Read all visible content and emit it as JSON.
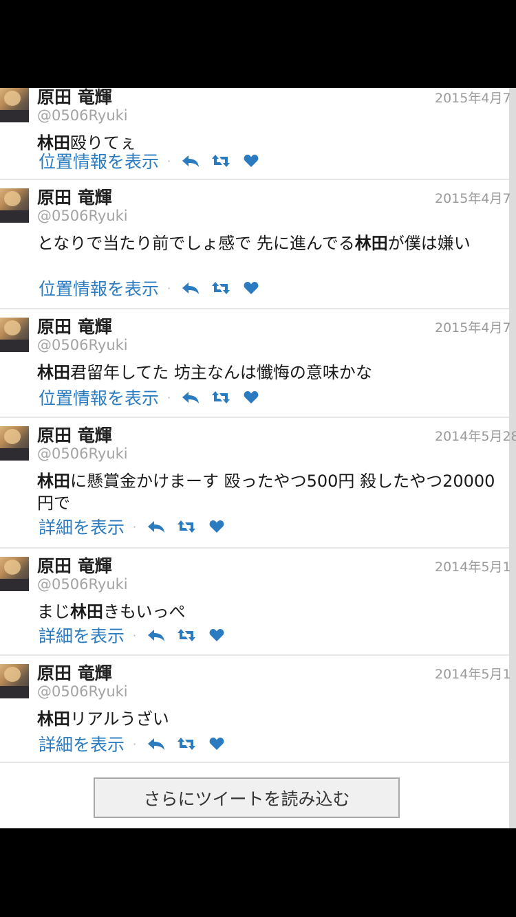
{
  "tweets": [
    {
      "name": "原田 竜輝",
      "handle": "@0506Ryuki",
      "date": "2015年4月7",
      "text_bold": "林田",
      "text_rest": "殴りてぇ",
      "link": "位置情報を表示"
    },
    {
      "name": "原田 竜輝",
      "handle": "@0506Ryuki",
      "date": "2015年4月7",
      "text_pre": "となりで当たり前でしょ感で 先に進んでる",
      "text_bold": "林田",
      "text_rest": "が僕は嫌い",
      "link": "位置情報を表示"
    },
    {
      "name": "原田 竜輝",
      "handle": "@0506Ryuki",
      "date": "2015年4月7",
      "text_bold": "林田",
      "text_rest": "君留年してた 坊主なんは懺悔の意味かな",
      "link": "位置情報を表示"
    },
    {
      "name": "原田 竜輝",
      "handle": "@0506Ryuki",
      "date": "2014年5月28",
      "text_bold": "林田",
      "text_rest": "に懸賞金かけまーす 殴ったやつ500円 殺したやつ20000円で",
      "link": "詳細を表示"
    },
    {
      "name": "原田 竜輝",
      "handle": "@0506Ryuki",
      "date": "2014年5月1",
      "text_pre": "まじ",
      "text_bold": "林田",
      "text_rest": "きもいっぺ",
      "link": "詳細を表示"
    },
    {
      "name": "原田 竜輝",
      "handle": "@0506Ryuki",
      "date": "2014年5月1",
      "text_bold": "林田",
      "text_rest": "リアルうざい",
      "link": "詳細を表示"
    }
  ],
  "separator": "·",
  "icons": {
    "reply": "reply-icon",
    "retweet": "retweet-icon",
    "favorite": "heart-icon"
  },
  "colors": {
    "link": "#2b7bc0",
    "icon": "#2b7bc0"
  },
  "load_more_label": "さらにツイートを読み込む"
}
